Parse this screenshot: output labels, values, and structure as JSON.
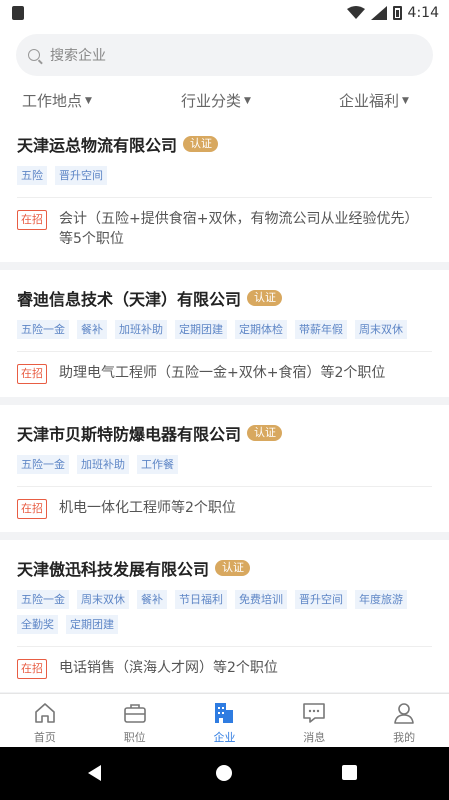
{
  "status": {
    "time": "4:14"
  },
  "search": {
    "placeholder": "搜索企业"
  },
  "filters": [
    "工作地点",
    "行业分类",
    "企业福利"
  ],
  "companies": [
    {
      "name": "天津运总物流有限公司",
      "badge": "认证",
      "tags": [
        "五险",
        "晋升空间"
      ],
      "hiring": "在招",
      "job": "会计（五险+提供食宿+双休，有物流公司从业经验优先）等5个职位"
    },
    {
      "name": "睿迪信息技术（天津）有限公司",
      "badge": "认证",
      "tags": [
        "五险一金",
        "餐补",
        "加班补助",
        "定期团建",
        "定期体检",
        "带薪年假",
        "周末双休"
      ],
      "hiring": "在招",
      "job": "助理电气工程师（五险一金+双休+食宿）等2个职位"
    },
    {
      "name": "天津市贝斯特防爆电器有限公司",
      "badge": "认证",
      "tags": [
        "五险一金",
        "加班补助",
        "工作餐"
      ],
      "hiring": "在招",
      "job": "机电一体化工程师等2个职位"
    },
    {
      "name": "天津傲迅科技发展有限公司",
      "badge": "认证",
      "tags": [
        "五险一金",
        "周末双休",
        "餐补",
        "节日福利",
        "免费培训",
        "晋升空间",
        "年度旅游",
        "全勤奖",
        "定期团建"
      ],
      "hiring": "在招",
      "job": "电话销售（滨海人才网）等2个职位"
    }
  ],
  "tabs": [
    "首页",
    "职位",
    "企业",
    "消息",
    "我的"
  ],
  "colors": {
    "accent": "#2f7ce1",
    "badge": "#d8a85f",
    "hiring": "#e85d43",
    "tag_text": "#5e86c6"
  }
}
